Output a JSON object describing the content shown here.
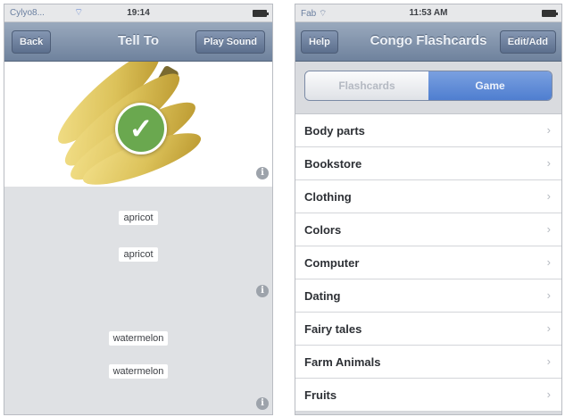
{
  "left": {
    "status": {
      "carrier": "Cylyo8...",
      "time": "19:14"
    },
    "nav": {
      "back": "Back",
      "title": "Tell To",
      "right": "Play Sound"
    },
    "words": [
      "apricot",
      "apricot",
      "watermelon",
      "watermelon"
    ]
  },
  "right": {
    "status": {
      "carrier": "Fab ⌔",
      "time": "11:53 AM"
    },
    "nav": {
      "left": "Help",
      "title": "Congo Flashcards",
      "right": "Edit/Add"
    },
    "segments": [
      "Flashcards",
      "Game"
    ],
    "selected_segment": "Game",
    "categories": [
      "Body parts",
      "Bookstore",
      "Clothing",
      "Colors",
      "Computer",
      "Dating",
      "Fairy tales",
      "Farm Animals",
      "Fruits"
    ]
  },
  "colors": {
    "nav": "#7f90ab",
    "segment_selected": "#5d89d6",
    "check": "#6aa84f"
  }
}
